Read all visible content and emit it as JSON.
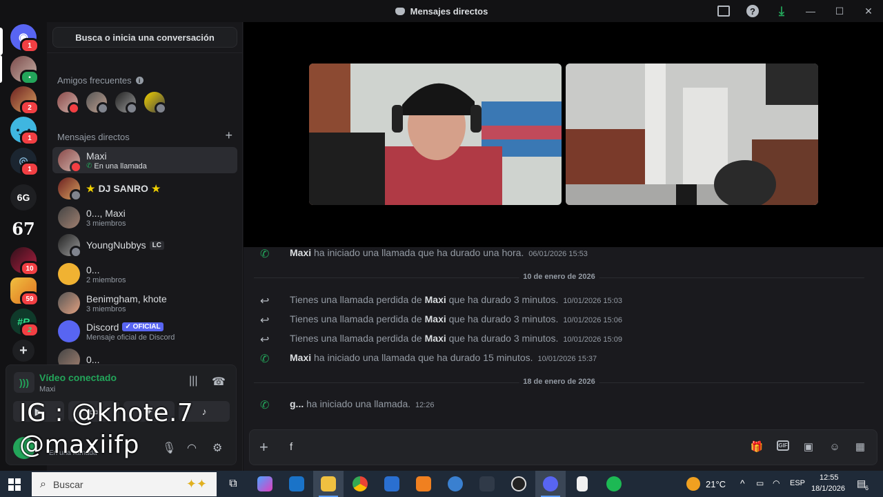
{
  "window": {
    "title": "Mensajes directos",
    "buttons": [
      "inbox",
      "help",
      "download",
      "minimize",
      "maximize",
      "close"
    ]
  },
  "rail": {
    "servers": [
      {
        "name": "home",
        "badge": "1"
      },
      {
        "name": "dm-avatar",
        "badge": ""
      },
      {
        "name": "server-2",
        "badge": "2"
      },
      {
        "name": "server-emoji",
        "badge": "1"
      },
      {
        "name": "server-swirl",
        "badge": "1"
      },
      {
        "name": "server-6g",
        "label": "6G",
        "badge": ""
      },
      {
        "name": "server-67",
        "label": "67",
        "badge": ""
      },
      {
        "name": "server-10",
        "badge": "10"
      },
      {
        "name": "server-59",
        "badge": "59"
      },
      {
        "name": "server-r",
        "label": "#R",
        "badge": "2"
      }
    ],
    "add_label": "+"
  },
  "sidebar": {
    "search_label": "Busca o inicia una conversación",
    "frequent_title": "Amigos frecuentes",
    "dm_title": "Mensajes directos",
    "dms": [
      {
        "name": "Maxi",
        "sub": "En una llamada",
        "active": true
      },
      {
        "name": "DJ SANRO",
        "sub": ""
      },
      {
        "name": "0..., Maxi",
        "sub": "3 miembros"
      },
      {
        "name": "YoungNubbys",
        "tag": "LC",
        "sub": ""
      },
      {
        "name": "0...",
        "sub": "2 miembros"
      },
      {
        "name": "Benimgham, khote",
        "sub": "3 miembros"
      },
      {
        "name": "Discord",
        "tag": "✓ OFICIAL",
        "sub": "Mensaje oficial de Discord"
      },
      {
        "name": "0...",
        "sub": ""
      }
    ]
  },
  "voice": {
    "status": "Vídeo conectado",
    "channel": "Maxi",
    "user_status": "En una llamada"
  },
  "overlay": {
    "line1": "IG : @khote.7",
    "line2": "@maxiifp"
  },
  "chat": {
    "messages": [
      {
        "type": "call",
        "author": "Maxi",
        "text": "ha iniciado una llamada que ha durado una hora.",
        "time": "06/01/2026 15:53"
      },
      {
        "type": "divider",
        "text": "10 de enero de 2026"
      },
      {
        "type": "missed",
        "prefix": "Tienes una llamada perdida de",
        "author": "Maxi",
        "text": "que ha durado 3 minutos.",
        "time": "10/01/2026 15:03"
      },
      {
        "type": "missed",
        "prefix": "Tienes una llamada perdida de",
        "author": "Maxi",
        "text": "que ha durado 3 minutos.",
        "time": "10/01/2026 15:06"
      },
      {
        "type": "missed",
        "prefix": "Tienes una llamada perdida de",
        "author": "Maxi",
        "text": "que ha durado 3 minutos.",
        "time": "10/01/2026 15:09"
      },
      {
        "type": "call",
        "author": "Maxi",
        "text": "ha iniciado una llamada que ha durado 15 minutos.",
        "time": "10/01/2026 15:37"
      },
      {
        "type": "divider",
        "text": "18 de enero de 2026"
      },
      {
        "type": "call",
        "author": "g...",
        "text": "ha iniciado una llamada.",
        "time": "12:26"
      }
    ],
    "composer_value": "f"
  },
  "taskbar": {
    "search_placeholder": "Buscar",
    "weather": "21°C",
    "lang": "ESP",
    "time": "12:55",
    "date": "18/1/2026",
    "notif_count": "6"
  },
  "colors": {
    "accent_green": "#23a55a",
    "badge_red": "#f23f43",
    "blurple": "#5865f2"
  }
}
